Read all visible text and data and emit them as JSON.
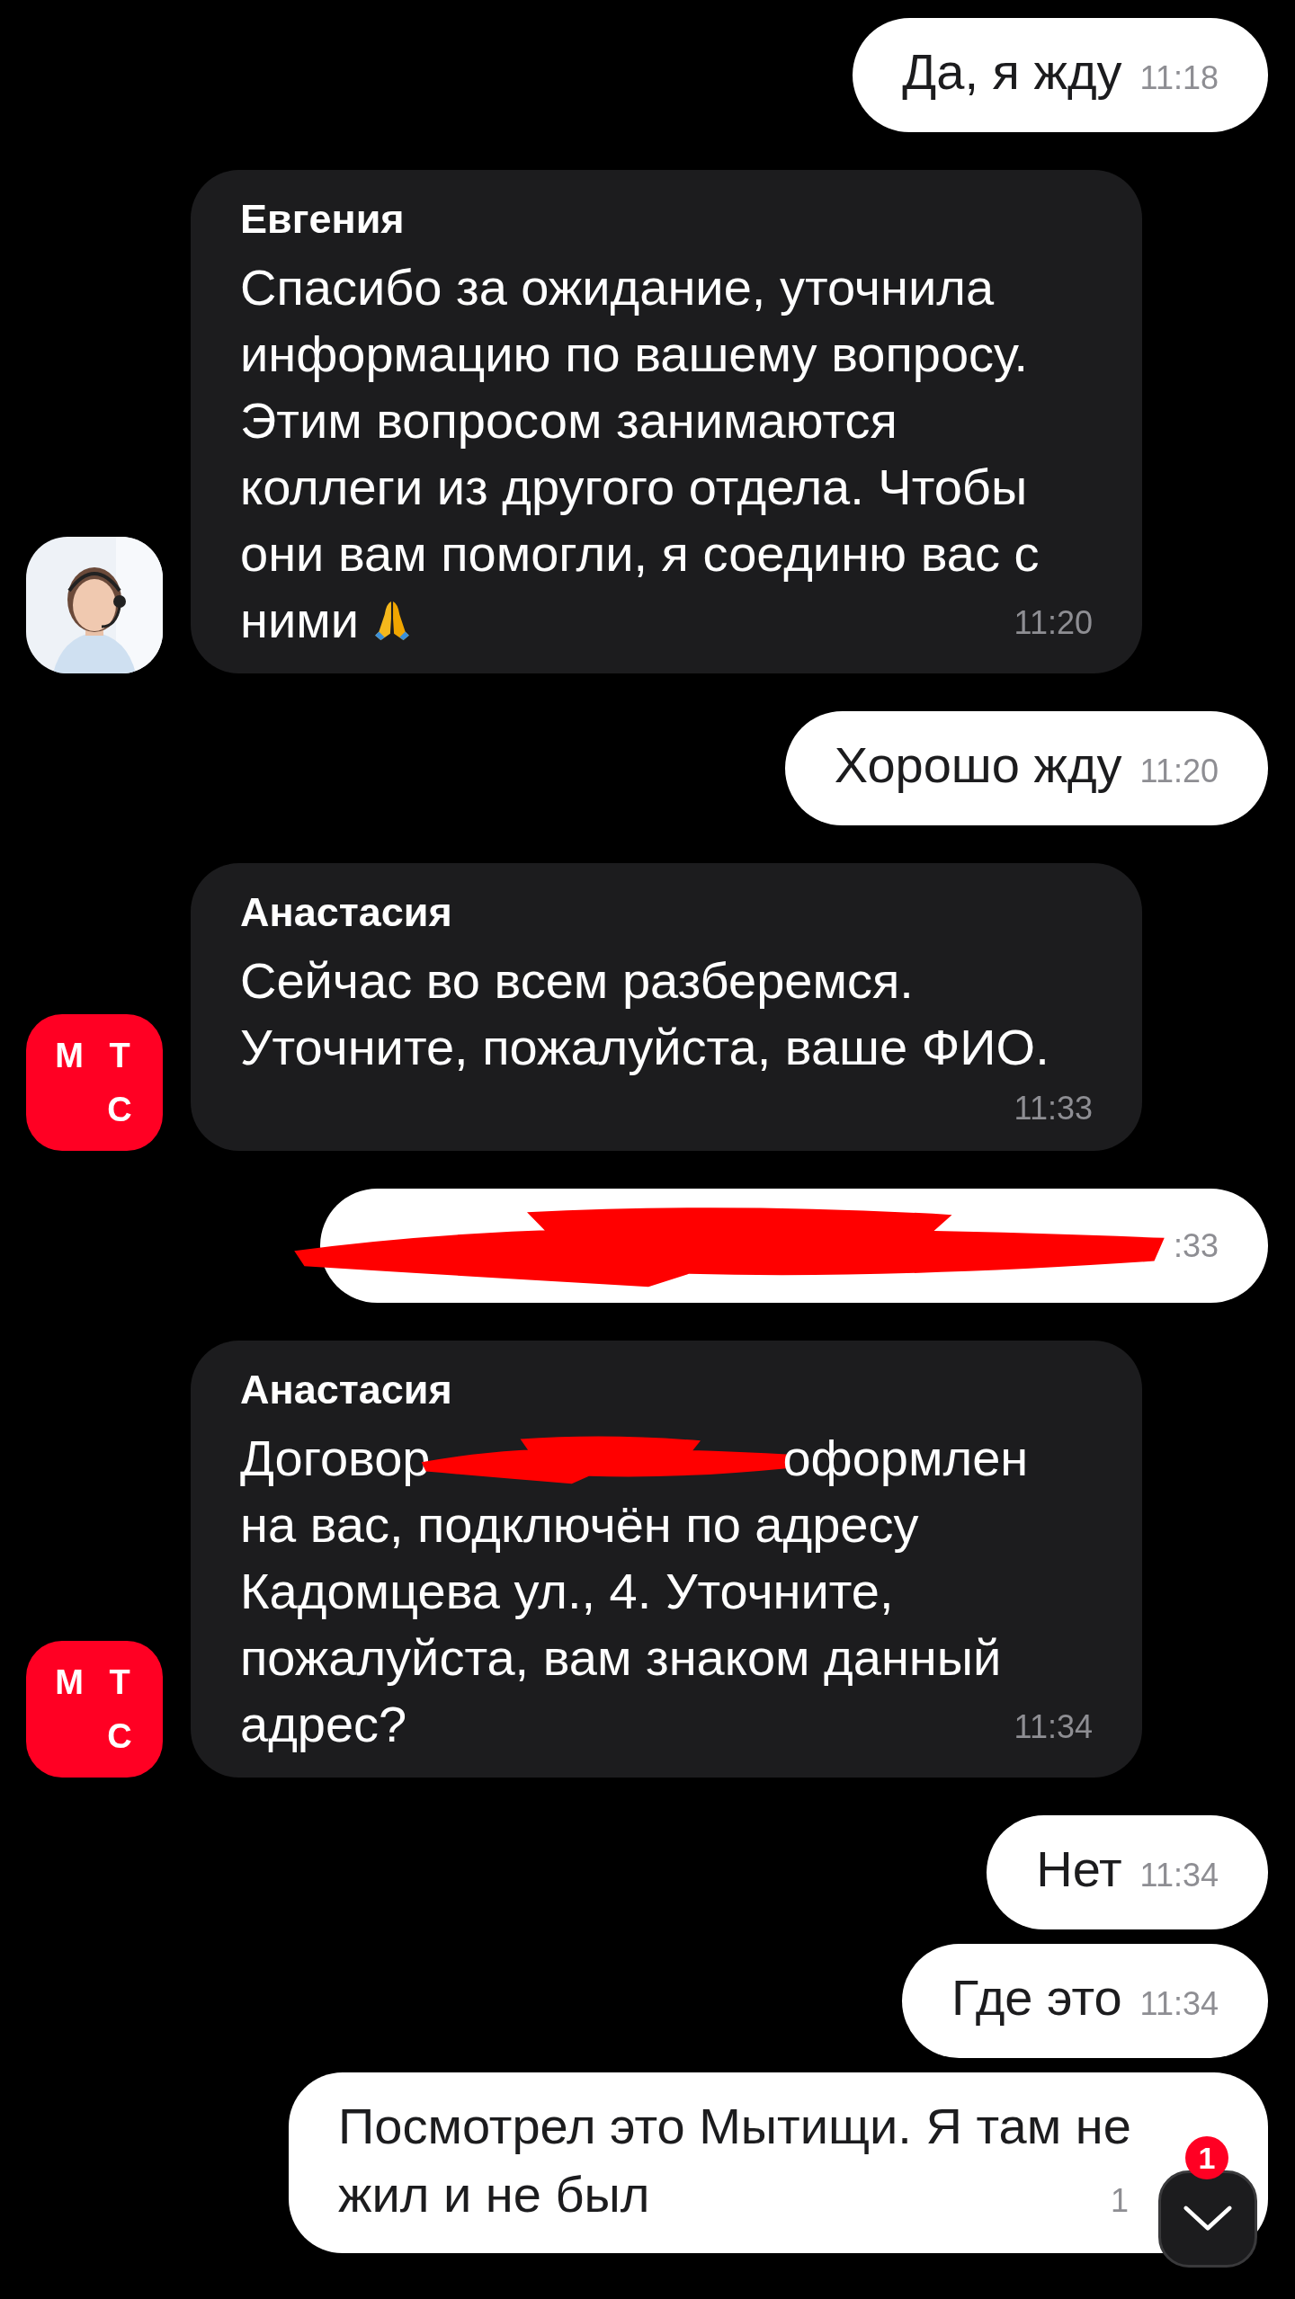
{
  "messages": [
    {
      "kind": "outgoing",
      "lines": [
        [
          {
            "kind": "text",
            "text": "Да, я жду"
          }
        ]
      ],
      "time": "11:18"
    },
    {
      "kind": "incoming",
      "sender": "Евгения",
      "avatar": {
        "kind": "picture"
      },
      "time": "11:20",
      "lines": [
        [
          {
            "kind": "text",
            "text": "Спасибо за ожидание, уточнила"
          }
        ],
        [
          {
            "kind": "text",
            "text": "информацию по вашему вопросу."
          }
        ],
        [
          {
            "kind": "text",
            "text": "Этим вопросом занимаются"
          }
        ],
        [
          {
            "kind": "text",
            "text": "коллеги из другого отдела. Чтобы"
          }
        ],
        [
          {
            "kind": "text",
            "text": "они вам помогли, я соединю вас с"
          }
        ],
        [
          {
            "kind": "text",
            "text": "ними"
          },
          {
            "kind": "emoji"
          }
        ]
      ]
    },
    {
      "kind": "outgoing",
      "lines": [
        [
          {
            "kind": "text",
            "text": "Хорошо жду"
          }
        ]
      ],
      "time": "11:20"
    },
    {
      "kind": "incoming",
      "sender": "Анастасия",
      "avatar": {
        "kind": "logo",
        "letters": [
          "М",
          "Т",
          "С"
        ]
      },
      "time": "11:33",
      "lines": [
        [
          {
            "kind": "text",
            "text": "Сейчас во всем разберемся."
          }
        ],
        [
          {
            "kind": "text",
            "text": "Уточните, пожалуйста, ваше ФИО."
          }
        ]
      ]
    },
    {
      "kind": "outgoing",
      "lines": [
        [
          {
            "kind": "redaction"
          }
        ]
      ],
      "time": ":33"
    },
    {
      "kind": "incoming",
      "sender": "Анастасия",
      "avatar": {
        "kind": "logo",
        "letters": [
          "М",
          "Т",
          "С"
        ]
      },
      "time": "11:34",
      "lines": [
        [
          {
            "kind": "text",
            "text": "Договор"
          },
          {
            "kind": "redaction"
          },
          {
            "kind": "text",
            "text": "оформлен"
          }
        ],
        [
          {
            "kind": "text",
            "text": "на вас, подключён по адресу"
          }
        ],
        [
          {
            "kind": "text",
            "text": "Кадомцева ул., 4. Уточните,"
          }
        ],
        [
          {
            "kind": "text",
            "text": "пожалуйста, вам знаком данный"
          }
        ],
        [
          {
            "kind": "text",
            "text": "адрес?"
          }
        ]
      ]
    },
    {
      "kind": "outgoing",
      "lines": [
        [
          {
            "kind": "text",
            "text": "Нет"
          }
        ]
      ],
      "time": "11:34"
    },
    {
      "kind": "outgoing",
      "lines": [
        [
          {
            "kind": "text",
            "text": "Где это"
          }
        ]
      ],
      "time": "11:34"
    },
    {
      "kind": "outgoing",
      "lines": [
        [
          {
            "kind": "text",
            "text": "Посмотрел это Мытищи. Я там не"
          }
        ],
        [
          {
            "kind": "text",
            "text": "жил и не был"
          }
        ]
      ],
      "time": "1"
    }
  ],
  "scroll_button": {
    "badge": "1"
  }
}
